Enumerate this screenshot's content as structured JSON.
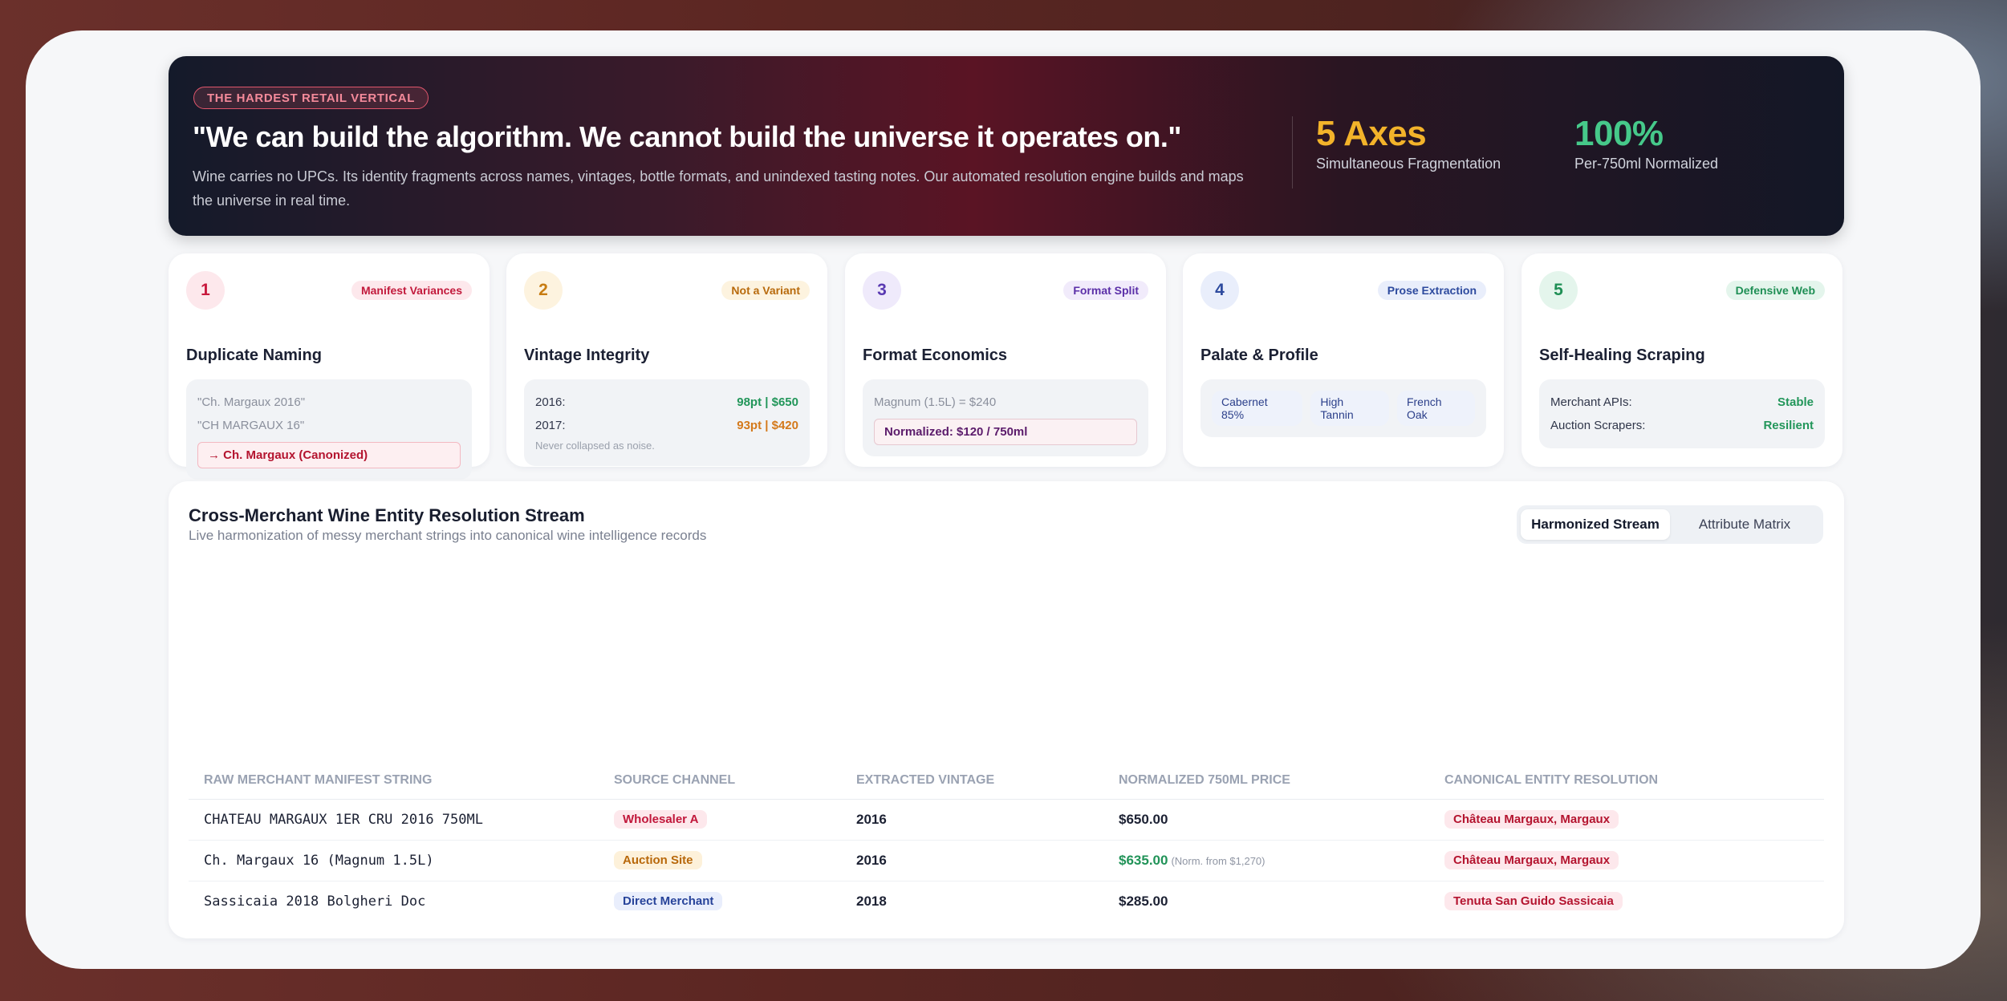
{
  "hero": {
    "pill": "THE HARDEST RETAIL VERTICAL",
    "quote": "\"We can build the algorithm. We cannot build the universe it operates on.\"",
    "desc": "Wine carries no UPCs. Its identity fragments across names, vintages, bottle formats, and unindexed tasting notes. Our automated resolution engine builds and maps the universe in real time.",
    "stat1_value": "5 Axes",
    "stat1_label": "Simultaneous Fragmentation",
    "stat2_value": "100%",
    "stat2_label": "Per-750ml Normalized"
  },
  "cards": {
    "c1": {
      "num": "1",
      "tag": "Manifest Variances",
      "title": "Duplicate Naming",
      "line1": "\"Ch. Margaux 2016\"",
      "line2": "\"CH MARGAUX 16\"",
      "canon": "→ Ch. Margaux (Canonized)"
    },
    "c2": {
      "num": "2",
      "tag": "Not a Variant",
      "title": "Vintage Integrity",
      "y1": "2016:",
      "v1": "98pt | $650",
      "y2": "2017:",
      "v2": "93pt | $420",
      "note": "Never collapsed as noise."
    },
    "c3": {
      "num": "3",
      "tag": "Format Split",
      "title": "Format Economics",
      "line": "Magnum (1.5L) = $240",
      "norm": "Normalized: $120 / 750ml"
    },
    "c4": {
      "num": "4",
      "tag": "Prose Extraction",
      "title": "Palate & Profile",
      "chips": [
        "Cabernet 85%",
        "High Tannin",
        "French Oak"
      ]
    },
    "c5": {
      "num": "5",
      "tag": "Defensive Web",
      "title": "Self-Healing Scraping",
      "k1": "Merchant APIs:",
      "v1": "Stable",
      "k2": "Auction Scrapers:",
      "v2": "Resilient"
    }
  },
  "panel": {
    "title": "Cross-Merchant Wine Entity Resolution Stream",
    "subtitle": "Live harmonization of messy merchant strings into canonical wine intelligence records",
    "tabs": [
      "Harmonized Stream",
      "Attribute Matrix"
    ]
  },
  "table": {
    "headers": [
      "RAW MERCHANT MANIFEST STRING",
      "SOURCE CHANNEL",
      "EXTRACTED VINTAGE",
      "NORMALIZED 750ML PRICE",
      "CANONICAL ENTITY RESOLUTION"
    ],
    "rows": [
      {
        "raw": "CHATEAU MARGAUX 1ER CRU 2016 750ML",
        "source": "Wholesaler A",
        "vintage": "2016",
        "price": "$650.00",
        "note": "",
        "canon": "Château Margaux, Margaux"
      },
      {
        "raw": "Ch. Margaux 16 (Magnum 1.5L)",
        "source": "Auction Site",
        "vintage": "2016",
        "price": "$635.00",
        "note": "(Norm. from $1,270)",
        "canon": "Château Margaux, Margaux"
      },
      {
        "raw": "Sassicaia 2018 Bolgheri Doc",
        "source": "Direct Merchant",
        "vintage": "2018",
        "price": "$285.00",
        "note": "",
        "canon": "Tenuta San Guido Sassicaia"
      }
    ]
  }
}
